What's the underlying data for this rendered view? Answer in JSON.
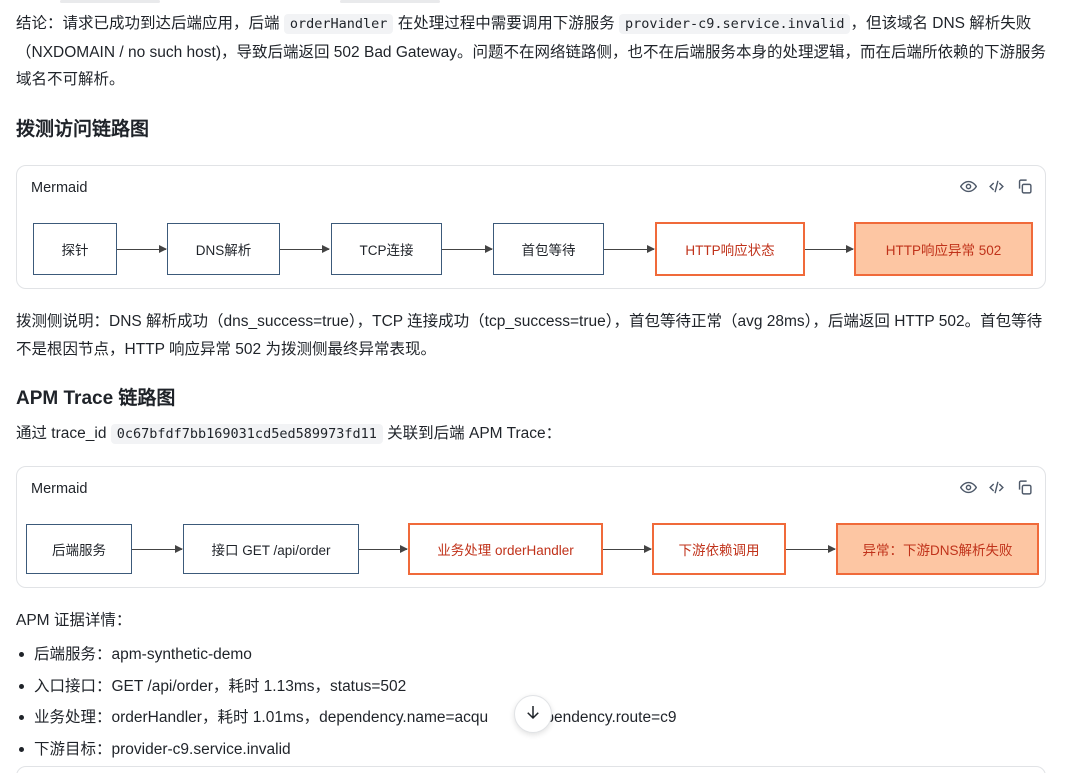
{
  "conclusion": {
    "prefix": "结论：请求已成功到达后端应用，后端",
    "code1": "orderHandler",
    "mid1": "在处理过程中需要调用下游服务",
    "code2": "provider-c9.service.invalid",
    "rest": "，但该域名 DNS 解析失败（NXDOMAIN / no such host)，导致后端返回 502 Bad Gateway。问题不在网络链路侧，也不在后端服务本身的处理逻辑，而在后端所依赖的下游服务域名不可解析。"
  },
  "probe_section": {
    "heading": "拨测访问链路图",
    "card_title": "Mermaid",
    "nodes": [
      "探针",
      "DNS解析",
      "TCP连接",
      "首包等待",
      "HTTP响应状态",
      "HTTP响应异常 502"
    ],
    "note": "拨测侧说明：DNS 解析成功（dns_success=true），TCP 连接成功（tcp_success=true），首包等待正常（avg 28ms），后端返回 HTTP 502。首包等待不是根因节点，HTTP 响应异常 502 为拨测侧最终异常表现。"
  },
  "apm_section": {
    "heading": "APM Trace 链路图",
    "trace_prefix": "通过 trace_id",
    "trace_id": "0c67bfdf7bb169031cd5ed589973fd11",
    "trace_suffix": "关联到后端 APM Trace：",
    "card_title": "Mermaid",
    "nodes": [
      "后端服务",
      "接口 GET /api/order",
      "业务处理 orderHandler",
      "下游依赖调用",
      "异常：下游DNS解析失败"
    ],
    "evidence_title": "APM 证据详情：",
    "evidence": [
      "后端服务：apm-synthetic-demo",
      "入口接口：GET /api/order，耗时 1.13ms，status=502",
      "业务处理：orderHandler，耗时 1.01ms，dependency.name=acqu",
      "下游目标：provider-c9.service.invalid"
    ],
    "evidence_tail": "dependency.route=c9"
  },
  "icons": [
    "eye-icon",
    "code-icon",
    "copy-icon",
    "arrow-down-icon"
  ],
  "colors": {
    "node_border": "#3c5a7a",
    "warn_border": "#f06a3a",
    "error_fill": "#fdc6a3",
    "warn_text": "#c0321a"
  }
}
